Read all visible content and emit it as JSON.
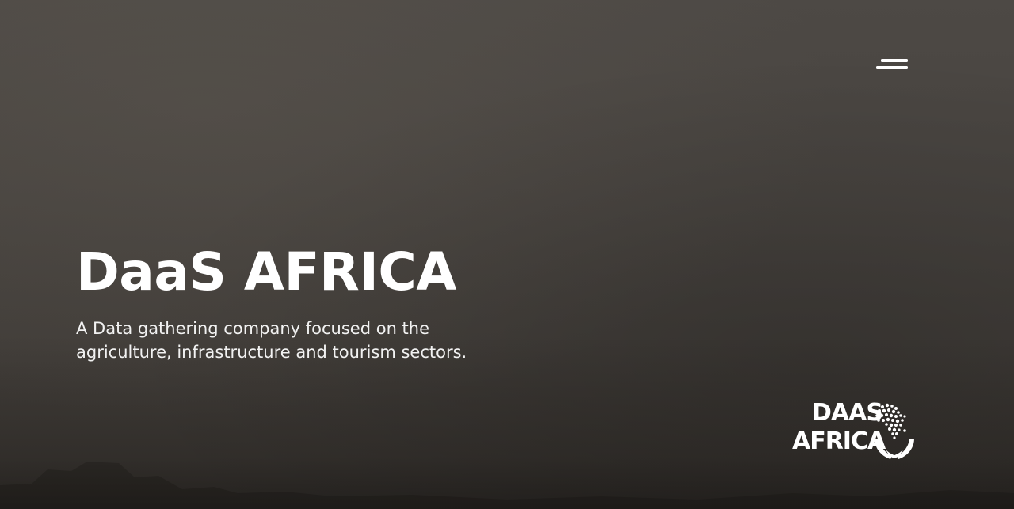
{
  "hero": {
    "title": "DaaS AFRICA",
    "subtitle": "A Data gathering company focused on the agriculture, infrastructure and tourism sectors."
  },
  "nav": {
    "menu_icon": "hamburger-menu-icon"
  },
  "brand": {
    "line1": "DAAS",
    "line2": "AFRICA",
    "logo_icon": "africa-map-hands-icon"
  },
  "colors": {
    "background": "#47433f",
    "text": "#ffffff"
  }
}
